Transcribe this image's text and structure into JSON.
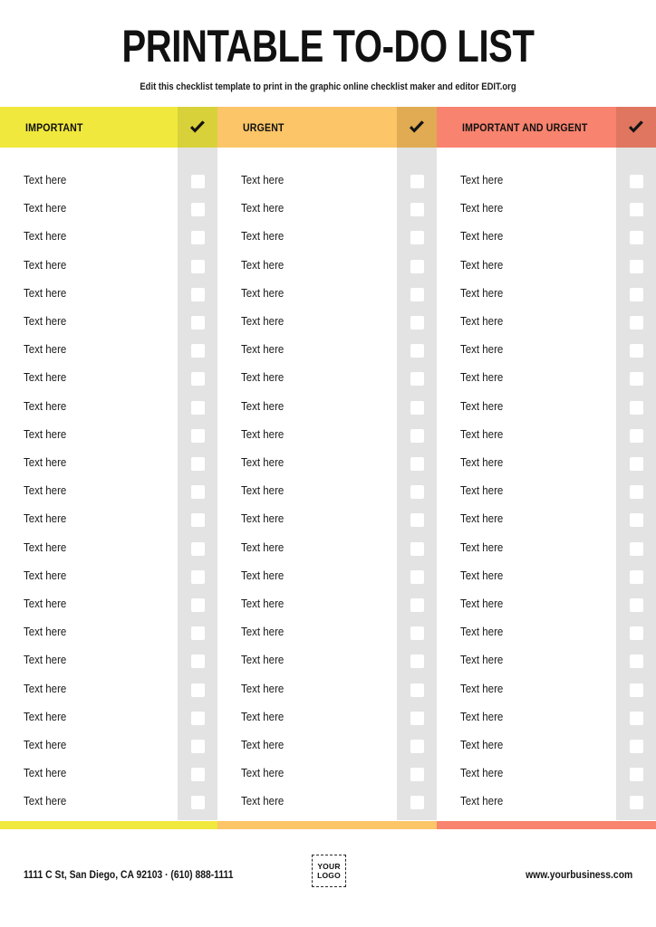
{
  "document": {
    "title": "PRINTABLE TO-DO LIST",
    "subtitle": "Edit this checklist template to print in the graphic online checklist maker and editor EDIT.org"
  },
  "colors": {
    "important": "#F0E83C",
    "important_check": "#D8D13A",
    "urgent": "#FCC568",
    "urgent_check": "#E0AB52",
    "important_and_urgent": "#F8836E",
    "important_and_urgent_check": "#E0765F",
    "rail_gray": "#E3E3E3",
    "checkbox": "#FFFFFF",
    "text": "#1A1A1A"
  },
  "columns": [
    {
      "label": "IMPORTANT",
      "check_icon": "checkmark-icon"
    },
    {
      "label": "URGENT",
      "check_icon": "checkmark-icon"
    },
    {
      "label": "IMPORTANT AND URGENT",
      "check_icon": "checkmark-icon"
    }
  ],
  "row_label": "Text here",
  "row_count": 23,
  "rows": [
    "Text here",
    "Text here",
    "Text here",
    "Text here",
    "Text here",
    "Text here",
    "Text here",
    "Text here",
    "Text here",
    "Text here",
    "Text here",
    "Text here",
    "Text here",
    "Text here",
    "Text here",
    "Text here",
    "Text here",
    "Text here",
    "Text here",
    "Text here",
    "Text here",
    "Text here",
    "Text here"
  ],
  "footer": {
    "address": "1111 C St, San Diego, CA 92103 · (610) 888-1111",
    "website": "www.yourbusiness.com",
    "logo_line1": "YOUR",
    "logo_line2": "LOGO"
  }
}
